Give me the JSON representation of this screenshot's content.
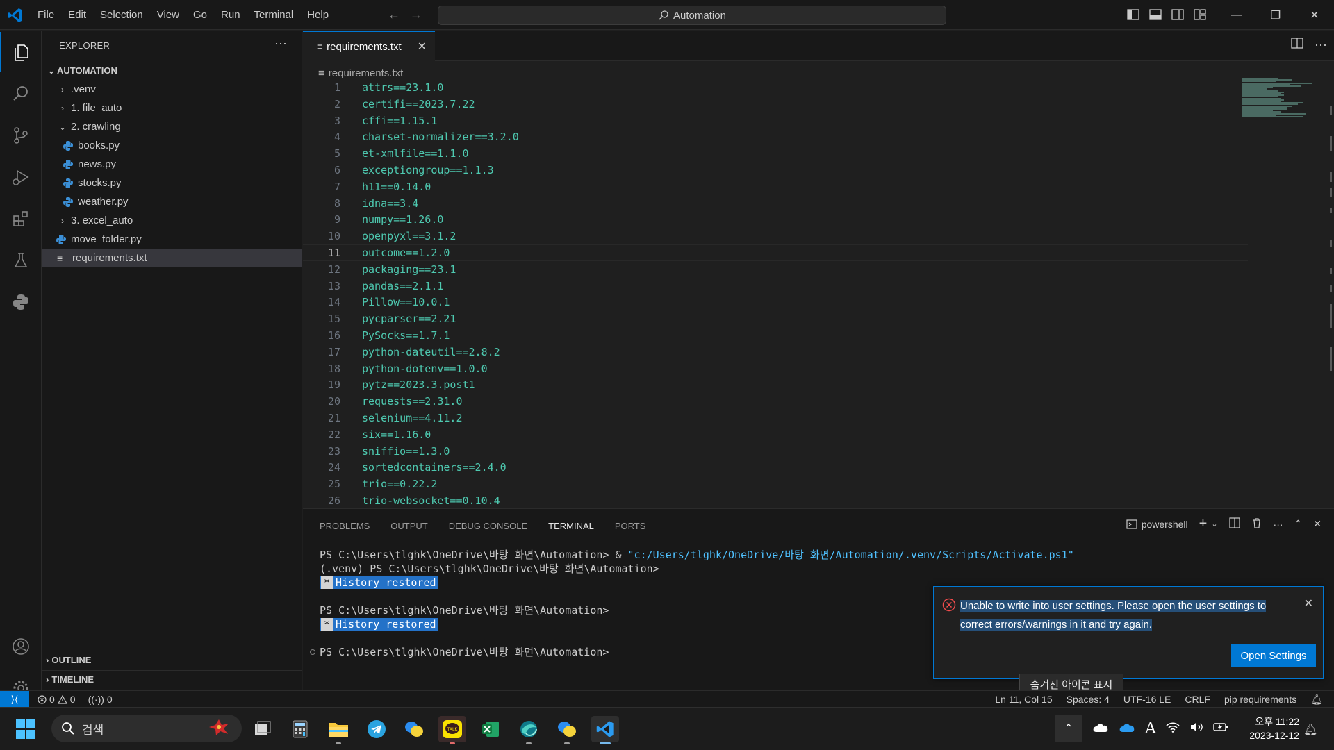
{
  "titlebar": {
    "menu": [
      "File",
      "Edit",
      "Selection",
      "View",
      "Go",
      "Run",
      "Terminal",
      "Help"
    ],
    "search_text": "Automation",
    "window_controls": {
      "minimize": "—",
      "restore": "❐",
      "close": "✕"
    }
  },
  "activitybar": {
    "items": [
      "explorer-icon",
      "search-icon",
      "source-control-icon",
      "run-debug-icon",
      "extensions-icon",
      "testing-icon",
      "python-icon",
      "account-icon",
      "settings-gear-icon"
    ]
  },
  "sidebar": {
    "title": "EXPLORER",
    "more": "···",
    "root": "AUTOMATION",
    "tree": [
      {
        "label": ".venv",
        "type": "folder",
        "expanded": false,
        "depth": 1
      },
      {
        "label": "1. file_auto",
        "type": "folder",
        "expanded": false,
        "depth": 1
      },
      {
        "label": "2. crawling",
        "type": "folder",
        "expanded": true,
        "depth": 1
      },
      {
        "label": "books.py",
        "type": "python",
        "depth": 2
      },
      {
        "label": "news.py",
        "type": "python",
        "depth": 2
      },
      {
        "label": "stocks.py",
        "type": "python",
        "depth": 2
      },
      {
        "label": "weather.py",
        "type": "python",
        "depth": 2
      },
      {
        "label": "3. excel_auto",
        "type": "folder",
        "expanded": false,
        "depth": 1
      },
      {
        "label": "move_folder.py",
        "type": "python",
        "depth": 1
      },
      {
        "label": "requirements.txt",
        "type": "text",
        "depth": 1,
        "selected": true
      }
    ],
    "outline": "OUTLINE",
    "timeline": "TIMELINE"
  },
  "editor": {
    "tab_label": "requirements.txt",
    "breadcrumb": "requirements.txt",
    "current_line": 11,
    "lines": [
      "attrs==23.1.0",
      "certifi==2023.7.22",
      "cffi==1.15.1",
      "charset-normalizer==3.2.0",
      "et-xmlfile==1.1.0",
      "exceptiongroup==1.1.3",
      "h11==0.14.0",
      "idna==3.4",
      "numpy==1.26.0",
      "openpyxl==3.1.2",
      "outcome==1.2.0",
      "packaging==23.1",
      "pandas==2.1.1",
      "Pillow==10.0.1",
      "pycparser==2.21",
      "PySocks==1.7.1",
      "python-dateutil==2.8.2",
      "python-dotenv==1.0.0",
      "pytz==2023.3.post1",
      "requests==2.31.0",
      "selenium==4.11.2",
      "six==1.16.0",
      "sniffio==1.3.0",
      "sortedcontainers==2.4.0",
      "trio==0.22.2",
      "trio-websocket==0.10.4"
    ]
  },
  "panel": {
    "tabs": [
      "PROBLEMS",
      "OUTPUT",
      "DEBUG CONSOLE",
      "TERMINAL",
      "PORTS"
    ],
    "active_tab": "TERMINAL",
    "shell": "powershell",
    "terminal": {
      "line1_prompt": "PS C:\\Users\\tlghk\\OneDrive\\바탕 화면\\Automation> & ",
      "line1_string": "\"c:/Users/tlghk/OneDrive/바탕 화면/Automation/.venv/Scripts/Activate.ps1\"",
      "line2": "(.venv) PS C:\\Users\\tlghk\\OneDrive\\바탕 화면\\Automation>",
      "history_star": "*",
      "history_text": "History restored",
      "line4": "PS C:\\Users\\tlghk\\OneDrive\\바탕 화면\\Automation>",
      "line6": "PS C:\\Users\\tlghk\\OneDrive\\바탕 화면\\Automation>"
    }
  },
  "notification": {
    "message_line1": "Unable to write into user settings. Please open the user settings to",
    "message_line2": "correct errors/warnings in it and try again.",
    "button": "Open Settings",
    "close": "✕"
  },
  "tooltip": "숨겨진 아이콘 표시",
  "statusbar": {
    "errors": "0",
    "warnings": "0",
    "ports": "0",
    "position": "Ln 11, Col 15",
    "spaces": "Spaces: 4",
    "encoding": "UTF-16 LE",
    "eol": "CRLF",
    "language": "pip requirements"
  },
  "taskbar": {
    "search_placeholder": "검색",
    "apps": [
      "task-view-icon",
      "calculator-icon",
      "file-explorer-icon",
      "telegram-icon",
      "chat-icon",
      "kakaotalk-icon",
      "excel-icon",
      "browser-icon",
      "chat-alt-icon",
      "vscode-icon"
    ],
    "tray_ime": "A",
    "clock_time": "오후 11:22",
    "clock_date": "2023-12-12"
  },
  "colors": {
    "accent": "#0078d4",
    "code_text": "#4ec9b0",
    "error": "#f14c4c"
  }
}
